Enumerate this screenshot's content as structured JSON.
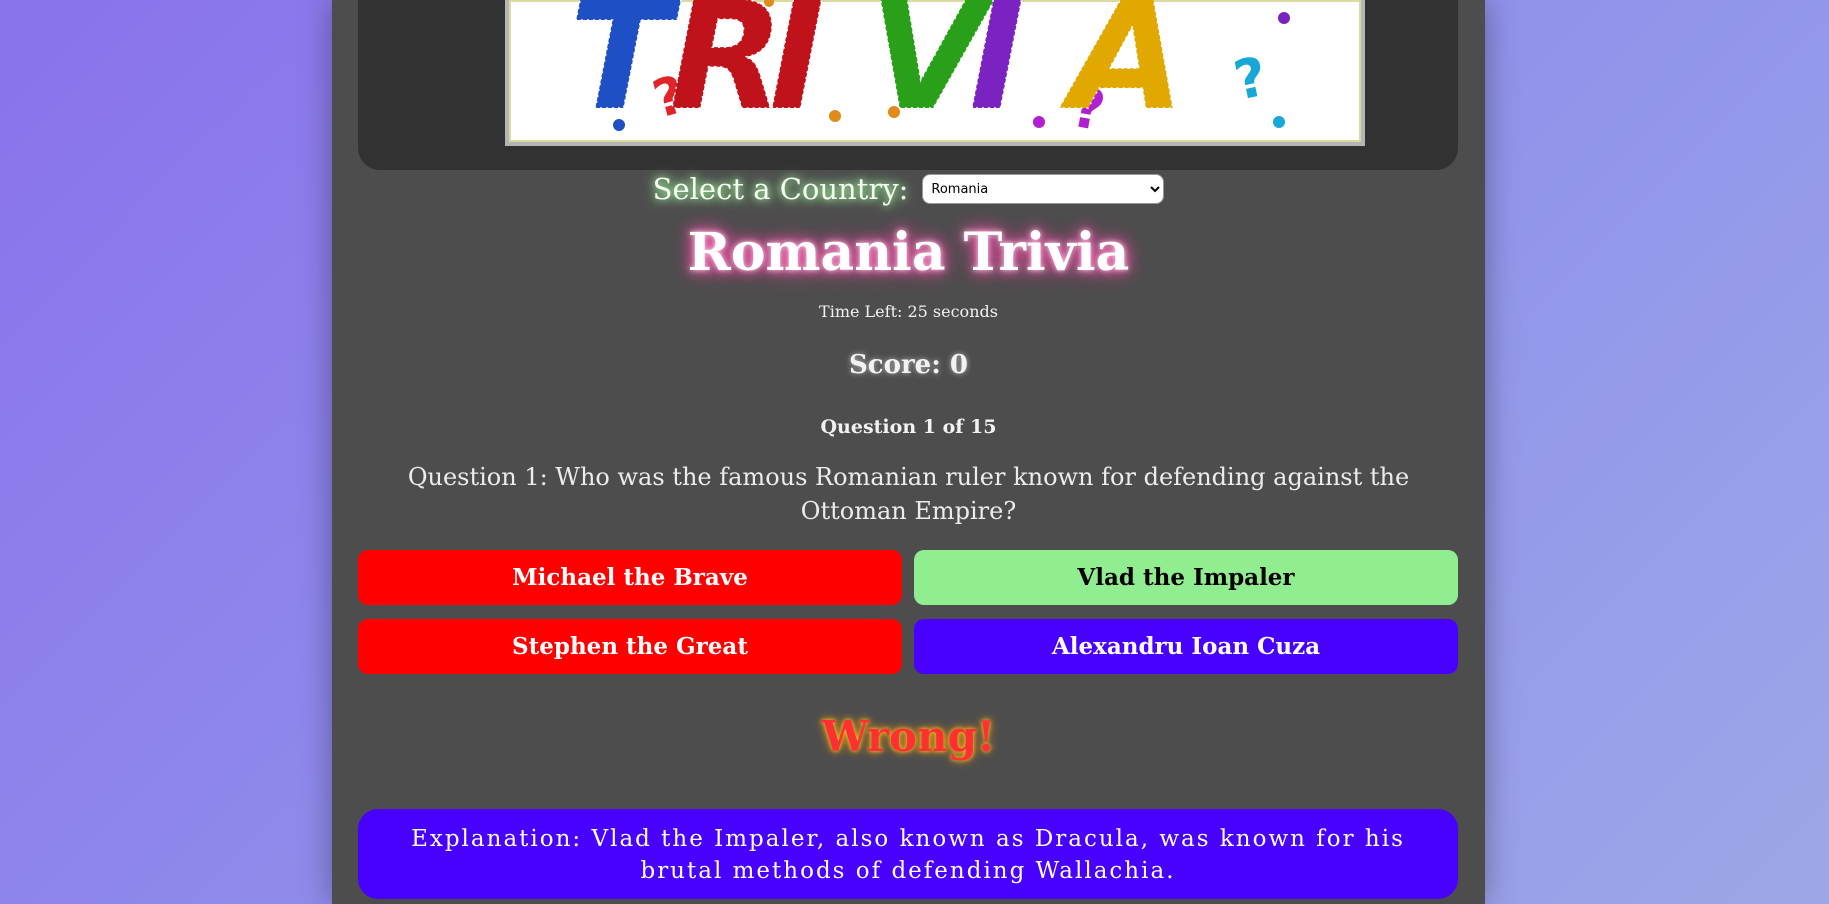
{
  "banner": {
    "logo_text": "TRIVIA",
    "letter_colors": [
      "#1f4fc4",
      "#c0121a",
      "#c0121a",
      "#2aa01a",
      "#7a23c0",
      "#e0a800",
      "#19a8c8"
    ]
  },
  "country_select": {
    "label": "Select a Country:",
    "selected": "Romania"
  },
  "quiz": {
    "title": "Romania Trivia",
    "timer": "Time Left: 25 seconds",
    "score": "Score: 0",
    "question_count": "Question 1 of 15",
    "question": "Question 1: Who was the famous Romanian ruler known for defending against the Ottoman Empire?"
  },
  "answers": [
    {
      "label": "Michael the Brave",
      "bg": "#ff0000",
      "fg": "#ffffff"
    },
    {
      "label": "Vlad the Impaler",
      "bg": "#90ee90",
      "fg": "#000000"
    },
    {
      "label": "Stephen the Great",
      "bg": "#ff0000",
      "fg": "#ffffff"
    },
    {
      "label": "Alexandru Ioan Cuza",
      "bg": "#4800ff",
      "fg": "#ffffff"
    }
  ],
  "result": "Wrong!",
  "explanation": "Explanation: Vlad the Impaler, also known as Dracula, was known for his brutal methods of defending Wallachia."
}
